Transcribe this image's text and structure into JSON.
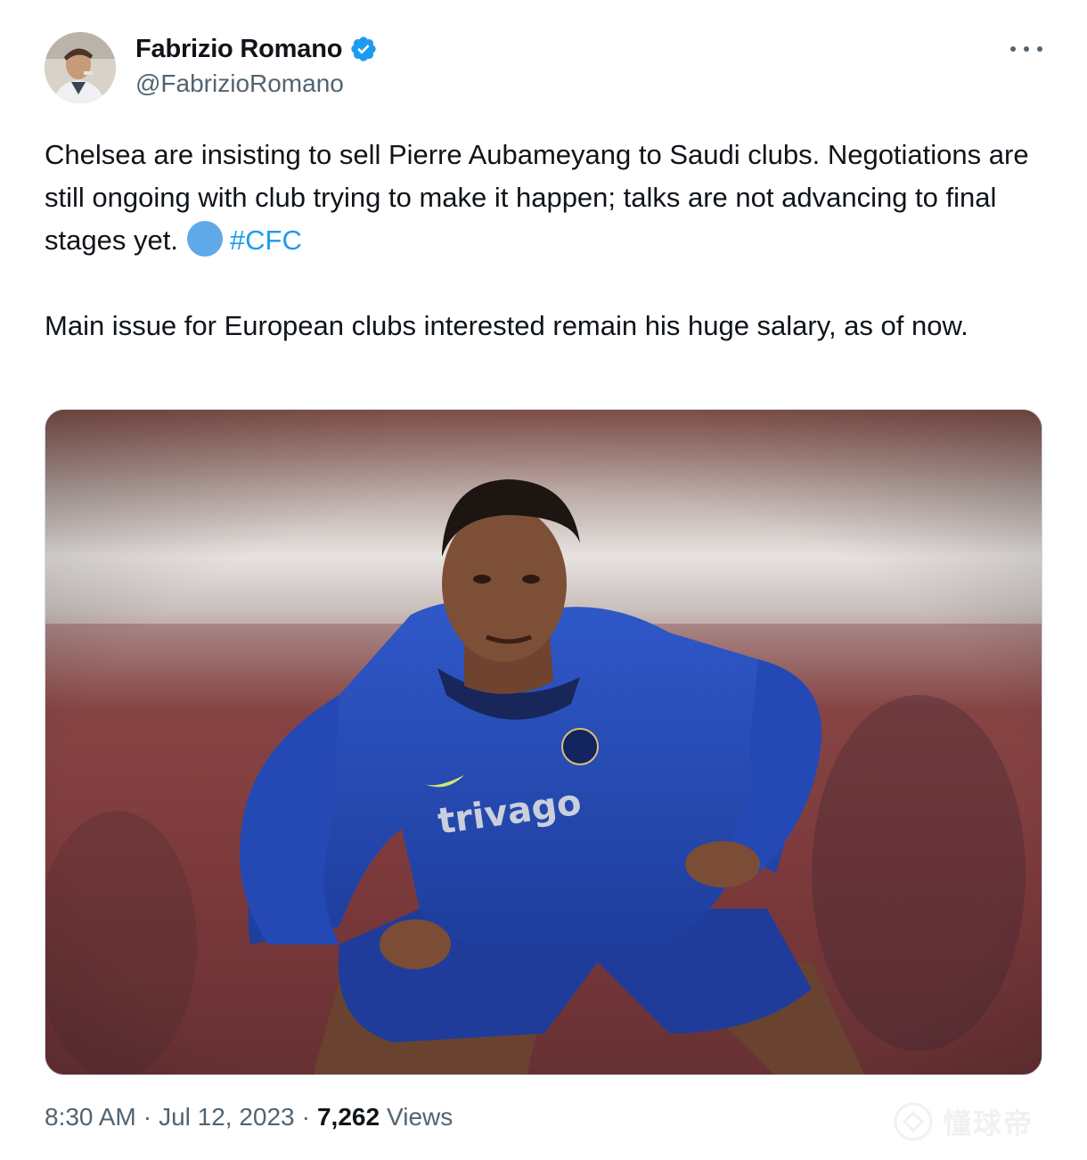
{
  "author": {
    "name": "Fabrizio Romano",
    "handle": "@FabrizioRomano",
    "verified": true
  },
  "tweet": {
    "paragraph1": "Chelsea are insisting to sell Pierre Aubameyang to Saudi clubs. Negotiations are still ongoing with club trying to make it happen; talks are not advancing to final stages yet.",
    "hashtag": "#CFC",
    "paragraph2": "Main issue for European clubs interested remain his huge salary, as of now."
  },
  "media": {
    "shirt_sponsor": "trivago"
  },
  "meta": {
    "time": "8:30 AM",
    "separator": "·",
    "date": "Jul 12, 2023",
    "views_count": "7,262",
    "views_label": "Views"
  },
  "watermark": {
    "text": "懂球帝"
  },
  "colors": {
    "text": "#0f1419",
    "secondary": "#536471",
    "link": "#1d9bf0",
    "verified": "#1d9bf0",
    "emoji_circle": "#5fa9e8"
  },
  "icons": {
    "verified": "verified-badge-icon",
    "more": "more-options-icon",
    "emoji": "blue-circle-emoji"
  }
}
